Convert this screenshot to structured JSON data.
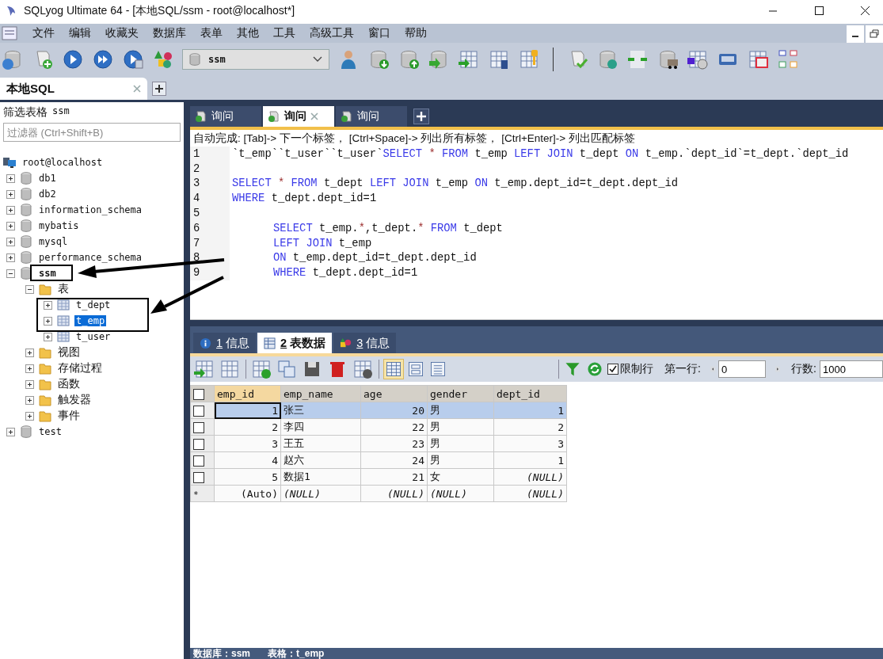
{
  "window": {
    "title": "SQLyog Ultimate 64 - [本地SQL/ssm - root@localhost*]"
  },
  "menu": [
    "文件",
    "编辑",
    "收藏夹",
    "数据库",
    "表单",
    "其他",
    "工具",
    "高级工具",
    "窗口",
    "帮助"
  ],
  "db_selector": {
    "value": "ssm"
  },
  "connection_tabs": [
    {
      "label": "本地SQL",
      "selected": true
    }
  ],
  "sidebar": {
    "filter_label": "筛选表格",
    "filter_db": "ssm",
    "filter": {
      "placeholder": "过滤器 (Ctrl+Shift+B)"
    },
    "tree": [
      {
        "label": "root@localhost",
        "kind": "server",
        "children": [
          {
            "label": "db1",
            "kind": "database",
            "expanded": false,
            "current": false,
            "selected": false
          },
          {
            "label": "db2",
            "kind": "database",
            "expanded": false,
            "current": false,
            "selected": false
          },
          {
            "label": "information_schema",
            "kind": "database",
            "expanded": false,
            "current": false,
            "selected": false
          },
          {
            "label": "mybatis",
            "kind": "database",
            "expanded": false,
            "current": false,
            "selected": false
          },
          {
            "label": "mysql",
            "kind": "database",
            "expanded": false,
            "current": false,
            "selected": false
          },
          {
            "label": "performance_schema",
            "kind": "database",
            "expanded": false,
            "current": false,
            "selected": false
          },
          {
            "label": "ssm",
            "kind": "database",
            "expanded": true,
            "current": true,
            "selected": false,
            "children": [
              {
                "label": "表",
                "kind": "folder",
                "expanded": true,
                "selected": false,
                "children": [
                  {
                    "label": "t_dept",
                    "kind": "table",
                    "expanded": false,
                    "selected": false
                  },
                  {
                    "label": "t_emp",
                    "kind": "table",
                    "expanded": false,
                    "selected": true
                  },
                  {
                    "label": "t_user",
                    "kind": "table",
                    "expanded": false,
                    "selected": false
                  }
                ]
              },
              {
                "label": "视图",
                "kind": "folder",
                "expanded": false,
                "selected": false
              },
              {
                "label": "存储过程",
                "kind": "folder",
                "expanded": false,
                "selected": false
              },
              {
                "label": "函数",
                "kind": "folder",
                "expanded": false,
                "selected": false
              },
              {
                "label": "触发器",
                "kind": "folder",
                "expanded": false,
                "selected": false
              },
              {
                "label": "事件",
                "kind": "folder",
                "expanded": false,
                "selected": false
              }
            ]
          },
          {
            "label": "test",
            "kind": "database",
            "expanded": false,
            "current": false,
            "selected": false
          }
        ]
      }
    ]
  },
  "query_tabs": [
    {
      "label": "询问",
      "selected": false
    },
    {
      "label": "询问",
      "selected": true
    },
    {
      "label": "询问",
      "selected": false
    }
  ],
  "editor": {
    "hint": "自动完成:  [Tab]-> 下一个标签， [Ctrl+Space]-> 列出所有标签， [Ctrl+Enter]-> 列出匹配标签",
    "lines": [
      {
        "number": "1",
        "indent": false,
        "tokens": [
          {
            "kind": "plain",
            "text": "`t_emp``t_user``t_user`"
          },
          {
            "kind": "keyword",
            "text": "SELECT "
          },
          {
            "kind": "operator",
            "text": "* "
          },
          {
            "kind": "keyword",
            "text": "FROM "
          },
          {
            "kind": "plain",
            "text": "t_emp "
          },
          {
            "kind": "keyword",
            "text": "LEFT JOIN "
          },
          {
            "kind": "plain",
            "text": "t_dept "
          },
          {
            "kind": "keyword",
            "text": "ON "
          },
          {
            "kind": "plain",
            "text": "t_emp.`dept_id`=t_dept.`dept_id"
          }
        ]
      },
      {
        "number": "2"
      },
      {
        "number": "3",
        "indent": false,
        "tokens": [
          {
            "kind": "keyword",
            "text": "SELECT "
          },
          {
            "kind": "operator",
            "text": "* "
          },
          {
            "kind": "keyword",
            "text": "FROM "
          },
          {
            "kind": "plain",
            "text": "t_dept "
          },
          {
            "kind": "keyword",
            "text": "LEFT JOIN "
          },
          {
            "kind": "plain",
            "text": "t_emp "
          },
          {
            "kind": "keyword",
            "text": "ON "
          },
          {
            "kind": "plain",
            "text": "t_emp.dept_id=t_dept.dept_id"
          }
        ]
      },
      {
        "number": "4",
        "indent": false,
        "tokens": [
          {
            "kind": "keyword",
            "text": "WHERE "
          },
          {
            "kind": "plain",
            "text": "t_dept.dept_id=1"
          }
        ]
      },
      {
        "number": "5"
      },
      {
        "number": "6",
        "indent": true,
        "tokens": [
          {
            "kind": "keyword",
            "text": "SELECT "
          },
          {
            "kind": "plain",
            "text": "t_emp."
          },
          {
            "kind": "operator",
            "text": "*"
          },
          {
            "kind": "plain",
            "text": ",t_dept."
          },
          {
            "kind": "operator",
            "text": "* "
          },
          {
            "kind": "keyword",
            "text": "FROM "
          },
          {
            "kind": "plain",
            "text": "t_dept"
          }
        ]
      },
      {
        "number": "7",
        "indent": true,
        "tokens": [
          {
            "kind": "keyword",
            "text": "LEFT JOIN "
          },
          {
            "kind": "plain",
            "text": "t_emp"
          }
        ]
      },
      {
        "number": "8",
        "indent": true,
        "tokens": [
          {
            "kind": "keyword",
            "text": "ON "
          },
          {
            "kind": "plain",
            "text": "t_emp.dept_id=t_dept.dept_id"
          }
        ]
      },
      {
        "number": "9",
        "indent": true,
        "tokens": [
          {
            "kind": "keyword",
            "text": "WHERE "
          },
          {
            "kind": "plain",
            "text": "t_dept.dept_id=1"
          }
        ]
      }
    ]
  },
  "result_tabs": [
    {
      "hotkey": "1",
      "label": "信息",
      "kind": "info",
      "selected": false
    },
    {
      "hotkey": "2",
      "label": "表数据",
      "kind": "table",
      "selected": true
    },
    {
      "hotkey": "3",
      "label": "信息",
      "kind": "shapes",
      "selected": false
    }
  ],
  "result_toolbar": {
    "limit_label": "限制行",
    "limit_checked": true,
    "first_row_label": "第一行:",
    "first_row": "0",
    "rows_label": "行数:",
    "rows": "1000"
  },
  "table": {
    "all_checked": false,
    "columns": [
      {
        "name": "emp_id",
        "numeric": true,
        "selected": true
      },
      {
        "name": "emp_name",
        "numeric": false,
        "selected": false
      },
      {
        "name": "age",
        "numeric": true,
        "selected": false
      },
      {
        "name": "gender",
        "numeric": false,
        "selected": false
      },
      {
        "name": "dept_id",
        "numeric": true,
        "selected": false
      }
    ],
    "rows": [
      {
        "kind": "data",
        "selected": true,
        "checked": false,
        "cells": [
          "1",
          "张三",
          "20",
          "男",
          "1"
        ]
      },
      {
        "kind": "data",
        "selected": false,
        "checked": false,
        "cells": [
          "2",
          "李四",
          "22",
          "男",
          "2"
        ]
      },
      {
        "kind": "data",
        "selected": false,
        "checked": false,
        "cells": [
          "3",
          "王五",
          "23",
          "男",
          "3"
        ]
      },
      {
        "kind": "data",
        "selected": false,
        "checked": false,
        "cells": [
          "4",
          "赵六",
          "24",
          "男",
          "1"
        ]
      },
      {
        "kind": "data",
        "selected": false,
        "checked": false,
        "cells": [
          "5",
          "数据1",
          "21",
          "女",
          {
            "text": "(NULL)",
            "null": true
          }
        ]
      },
      {
        "kind": "new",
        "marker": "*",
        "selected": false,
        "cells": [
          "(Auto)",
          {
            "text": "(NULL)",
            "null": true
          },
          {
            "text": "(NULL)",
            "null": true
          },
          {
            "text": "(NULL)",
            "null": true
          },
          {
            "text": "(NULL)",
            "null": true
          }
        ]
      }
    ]
  },
  "status_bar": {
    "db_label": "数据库：",
    "db": "ssm",
    "table_label": "表格：",
    "table": "t_emp"
  }
}
